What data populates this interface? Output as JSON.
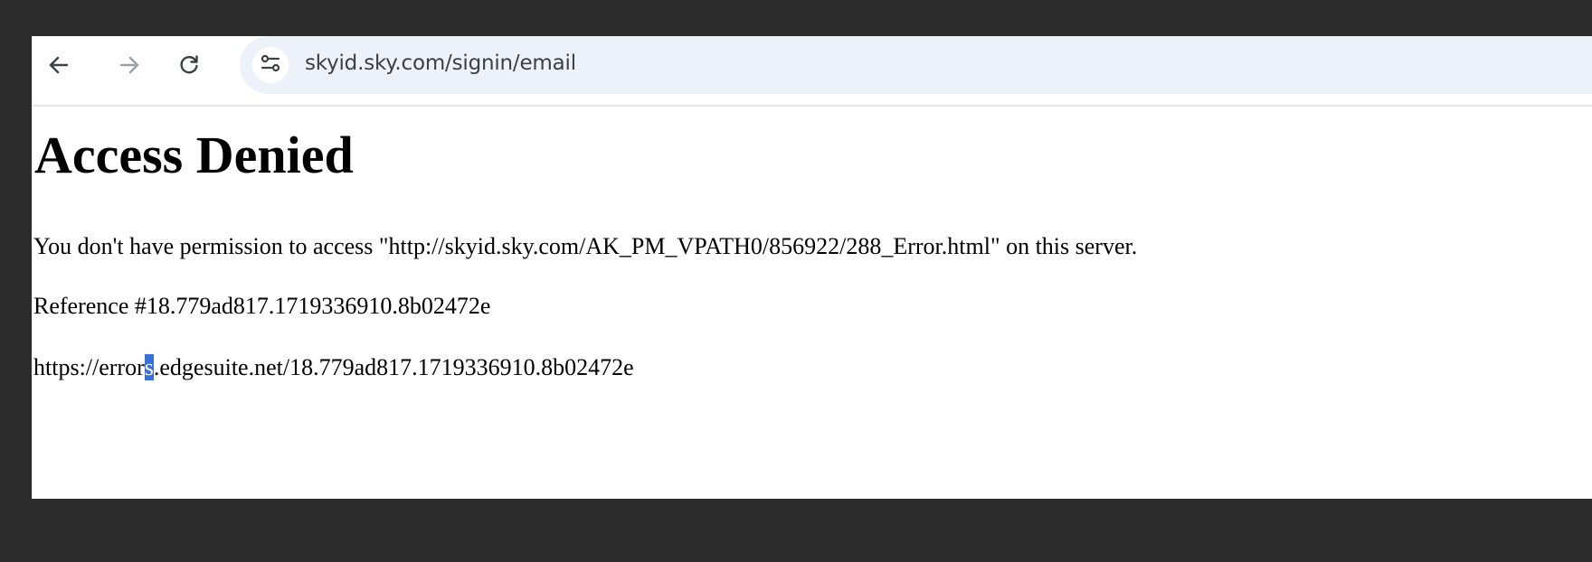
{
  "browser": {
    "url": "skyid.sky.com/signin/email",
    "icons": {
      "back": "arrow-left-icon",
      "forward": "arrow-right-icon",
      "reload": "reload-icon",
      "site_info": "tune-icon"
    }
  },
  "page": {
    "heading": "Access Denied",
    "message": "You don't have permission to access \"http://skyid.sky.com/AK_PM_VPATH0/856922/288_Error.html\" on this server.",
    "reference": "Reference #18.779ad817.1719336910.8b02472e",
    "error_link": {
      "before_selection": "https://error",
      "selected": "s",
      "after_selection": ".edgesuite.net/18.779ad817.1719336910.8b02472e"
    }
  },
  "colors": {
    "frame_background": "#2b2b2b",
    "omnibox_background": "#edf1f9",
    "selection_highlight": "#3a6fd8"
  }
}
